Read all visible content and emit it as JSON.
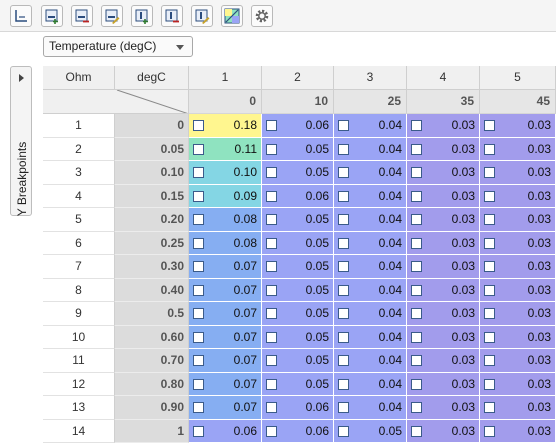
{
  "toolbar": {
    "buttons": [
      {
        "icon": "axis-icon",
        "name": "axis-button"
      },
      {
        "icon": "add-row-icon",
        "name": "add-row-button"
      },
      {
        "icon": "remove-row-icon",
        "name": "remove-row-button"
      },
      {
        "icon": "edit-row-icon",
        "name": "edit-row-button"
      },
      {
        "icon": "add-column-icon",
        "name": "add-column-button"
      },
      {
        "icon": "remove-column-icon",
        "name": "remove-column-button"
      },
      {
        "icon": "edit-column-icon",
        "name": "edit-column-button"
      },
      {
        "icon": "heatmap-icon",
        "name": "heatmap-button"
      },
      {
        "icon": "gear-icon",
        "name": "settings-button"
      }
    ]
  },
  "dropdown": {
    "selected": "Temperature (degC)"
  },
  "side_panel": {
    "label": "Y Breakpoints"
  },
  "table": {
    "row_axis_label": "Ohm",
    "col_axis_label": "degC",
    "column_indices": [
      "1",
      "2",
      "3",
      "4",
      "5"
    ],
    "column_breakpoints": [
      "0",
      "10",
      "25",
      "35",
      "45"
    ],
    "rows": [
      {
        "index": "1",
        "bp": "0",
        "values": [
          "0.18",
          "0.06",
          "0.04",
          "0.03",
          "0.03"
        ]
      },
      {
        "index": "2",
        "bp": "0.05",
        "values": [
          "0.11",
          "0.05",
          "0.04",
          "0.03",
          "0.03"
        ]
      },
      {
        "index": "3",
        "bp": "0.10",
        "values": [
          "0.10",
          "0.05",
          "0.04",
          "0.03",
          "0.03"
        ]
      },
      {
        "index": "4",
        "bp": "0.15",
        "values": [
          "0.09",
          "0.06",
          "0.04",
          "0.03",
          "0.03"
        ]
      },
      {
        "index": "5",
        "bp": "0.20",
        "values": [
          "0.08",
          "0.05",
          "0.04",
          "0.03",
          "0.03"
        ]
      },
      {
        "index": "6",
        "bp": "0.25",
        "values": [
          "0.08",
          "0.05",
          "0.04",
          "0.03",
          "0.03"
        ]
      },
      {
        "index": "7",
        "bp": "0.30",
        "values": [
          "0.07",
          "0.05",
          "0.04",
          "0.03",
          "0.03"
        ]
      },
      {
        "index": "8",
        "bp": "0.40",
        "values": [
          "0.07",
          "0.05",
          "0.04",
          "0.03",
          "0.03"
        ]
      },
      {
        "index": "9",
        "bp": "0.5",
        "values": [
          "0.07",
          "0.05",
          "0.04",
          "0.03",
          "0.03"
        ]
      },
      {
        "index": "10",
        "bp": "0.60",
        "values": [
          "0.07",
          "0.05",
          "0.04",
          "0.03",
          "0.03"
        ]
      },
      {
        "index": "11",
        "bp": "0.70",
        "values": [
          "0.07",
          "0.05",
          "0.04",
          "0.03",
          "0.03"
        ]
      },
      {
        "index": "12",
        "bp": "0.80",
        "values": [
          "0.07",
          "0.05",
          "0.04",
          "0.03",
          "0.03"
        ]
      },
      {
        "index": "13",
        "bp": "0.90",
        "values": [
          "0.07",
          "0.06",
          "0.04",
          "0.03",
          "0.03"
        ]
      },
      {
        "index": "14",
        "bp": "1",
        "values": [
          "0.06",
          "0.06",
          "0.05",
          "0.03",
          "0.03"
        ]
      }
    ]
  },
  "colors": {
    "heat_max": "#fff68f",
    "heat_high": "#8fe3c0",
    "heat_mid": "#84d6e4",
    "heat_lowmid": "#86aef2",
    "heat_low": "#9aa4f5",
    "heat_min": "#a29cec"
  }
}
